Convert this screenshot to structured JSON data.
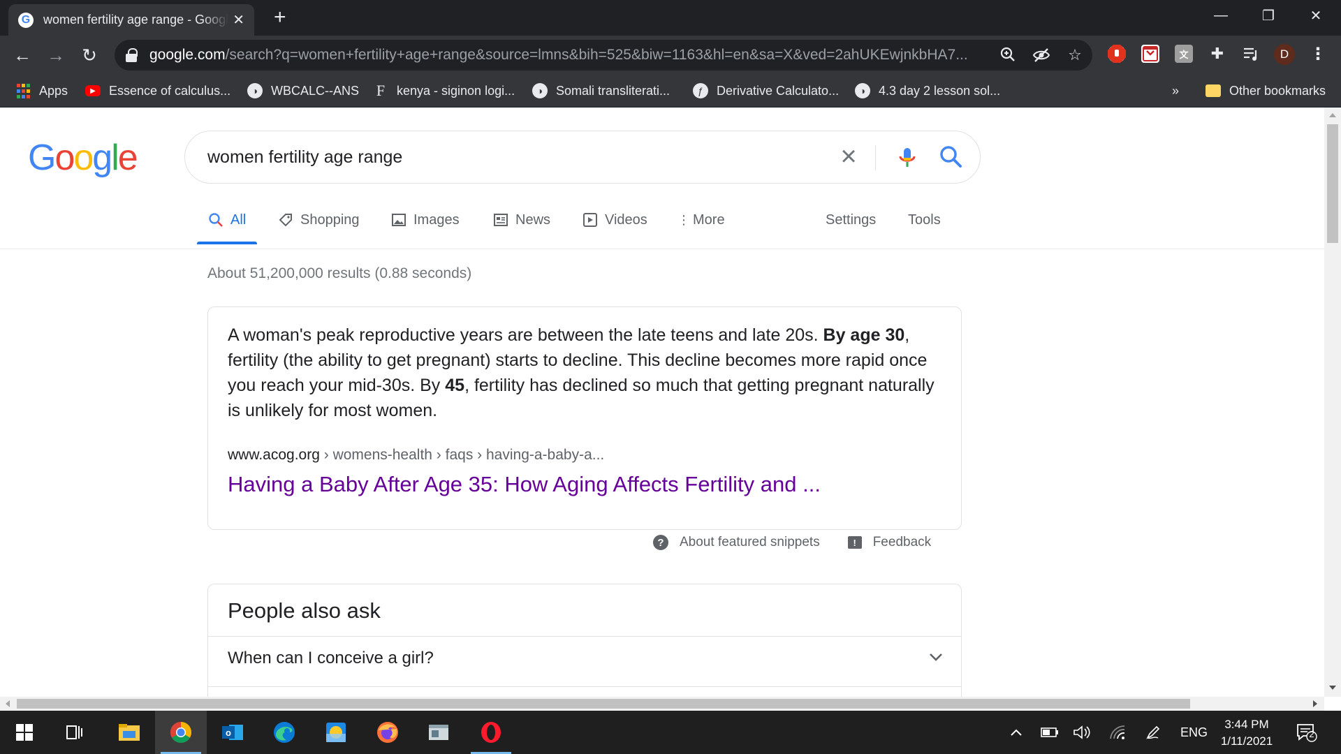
{
  "browser": {
    "tab_title": "women fertility age range - Google Search",
    "tab_close": "✕",
    "new_tab": "+",
    "window_controls": {
      "minimize": "—",
      "restore": "❐",
      "close": "✕"
    },
    "url_host": "google.com",
    "url_path": "/search?q=women+fertility+age+range&source=lmns&bih=525&biw=1163&hl=en&sa=X&ved=2ahUKEwjnkbHA7...",
    "profile_initial": "D",
    "bookmarks": [
      "Apps",
      "Essence of calculus...",
      "WBCALC--ANS",
      "kenya - siginon logi...",
      "Somali transliterati...",
      "Derivative Calculato...",
      "4.3 day 2 lesson sol..."
    ],
    "bookmarks_more": "»",
    "other_bookmarks": "Other bookmarks"
  },
  "google": {
    "logo_letters": [
      "G",
      "o",
      "o",
      "g",
      "l",
      "e"
    ],
    "logo_colors": [
      "#4285F4",
      "#EA4335",
      "#FBBC05",
      "#4285F4",
      "#34A853",
      "#EA4335"
    ],
    "query": "women fertility age range",
    "clear_glyph": "×",
    "tabs": [
      {
        "label": "All",
        "icon": "search-icon"
      },
      {
        "label": "Shopping",
        "icon": "tag-icon"
      },
      {
        "label": "Images",
        "icon": "image-icon"
      },
      {
        "label": "News",
        "icon": "news-icon"
      },
      {
        "label": "Videos",
        "icon": "video-icon"
      },
      {
        "label": "More",
        "icon": "more-vert-icon"
      }
    ],
    "settings": "Settings",
    "tools": "Tools",
    "result_stats": "About 51,200,000 results (0.88 seconds)"
  },
  "snippet": {
    "text_1": "A woman's peak reproductive years are between the late teens and late 20s. ",
    "bold_1": "By age 30",
    "text_2": ", fertility (the ability to get pregnant) starts to decline. This decline becomes more rapid once you reach your mid-30s. By ",
    "bold_2": "45",
    "text_3": ", fertility has declined so much that getting pregnant naturally is unlikely for most women.",
    "cite_host": "www.acog.org",
    "cite_path": " › womens-health › faqs › having-a-baby-a...",
    "title": "Having a Baby After Age 35: How Aging Affects Fertility and ...",
    "about": "About featured snippets",
    "feedback": "Feedback"
  },
  "paa": {
    "title": "People also ask",
    "questions": [
      "When can I conceive a girl?"
    ]
  },
  "taskbar": {
    "language": "ENG",
    "time": "3:44 PM",
    "date": "1/11/2021",
    "notifications": "2"
  },
  "colors": {
    "accent": "#1a73e8",
    "visited_link": "#660099"
  }
}
